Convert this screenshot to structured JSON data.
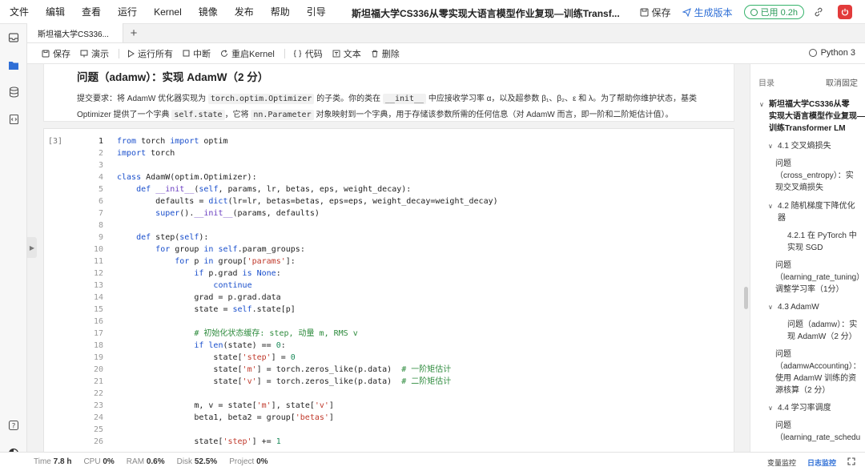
{
  "menu": [
    "文件",
    "编辑",
    "查看",
    "运行",
    "Kernel",
    "镜像",
    "发布",
    "帮助",
    "引导"
  ],
  "title": "斯坦福大学CS336从零实现大语言模型作业复现—训练Transf...",
  "top_actions": {
    "save": "保存",
    "publish": "生成版本",
    "usage": "已用 0.2h",
    "accent_color": "#2f6fd6",
    "usage_color": "#2a9a58",
    "stop_color": "#e23b3b"
  },
  "tab": {
    "label": "斯坦福大学CS336...",
    "add": "+"
  },
  "toolbar": {
    "save": "保存",
    "present": "演示",
    "run_all": "运行所有",
    "interrupt": "中断",
    "restart": "重启Kernel",
    "code": "代码",
    "text": "文本",
    "delete": "删除",
    "kernel": "Python 3"
  },
  "markdown": {
    "heading": "问题（adamw）：实现 AdamW（2 分）",
    "p1a": "提交要求：将 AdamW 优化器实现为 ",
    "p1_code1": "torch.optim.Optimizer",
    "p1b": " 的子类。你的类在 ",
    "p1_code2": "__init__",
    "p1c": " 中应接收学习率 α，以及超参数 β₁、β₂、ε 和 λ。为了帮助你维护状态，基类",
    "p2a": "Optimizer 提供了一个字典 ",
    "p2_code1": "self.state",
    "p2b": "，它将 ",
    "p2_code2": "nn.Parameter",
    "p2c": " 对象映射到一个字典，用于存储该参数所需的任何信息（对 AdamW 而言，即一阶和二阶矩估计值）。"
  },
  "code_cell": {
    "exec_count": "[3]",
    "line_numbers": [
      "1",
      "2",
      "3",
      "4",
      "5",
      "6",
      "7",
      "8",
      "9",
      "10",
      "11",
      "12",
      "13",
      "14",
      "15",
      "16",
      "17",
      "18",
      "19",
      "20",
      "21",
      "22",
      "23",
      "24",
      "25",
      "26"
    ]
  },
  "outline": {
    "title": "目录",
    "cancel": "取消固定",
    "items": [
      "斯坦福大学CS336从零",
      "实现大语言模型作业复现—",
      "训练Transformer LM",
      "4.1 交叉熵损失",
      "问题",
      "（cross_entropy）：实",
      "现交叉熵损失",
      "4.2 随机梯度下降优化",
      "器",
      "4.2.1 在 PyTorch 中",
      "实现 SGD",
      "问题",
      "（learning_rate_tuning）",
      "调整学习率（1分）",
      "4.3 AdamW",
      "问题（adamw）：实",
      "现 AdamW（2 分）",
      "问题",
      "（adamwAccounting）：",
      "使用 AdamW 训练的资",
      "源核算（2 分）",
      "4.4 学习率调度",
      "问题",
      "（learning_rate_schedu"
    ]
  },
  "status": {
    "time_label": "Time",
    "time": "7.8 h",
    "cpu_label": "CPU",
    "cpu": "0%",
    "ram_label": "RAM",
    "ram": "0.6%",
    "disk_label": "Disk",
    "disk": "52.5%",
    "project_label": "Project",
    "project": "0%",
    "tab_monitor": "变量监控",
    "tab_log": "日志监控"
  }
}
